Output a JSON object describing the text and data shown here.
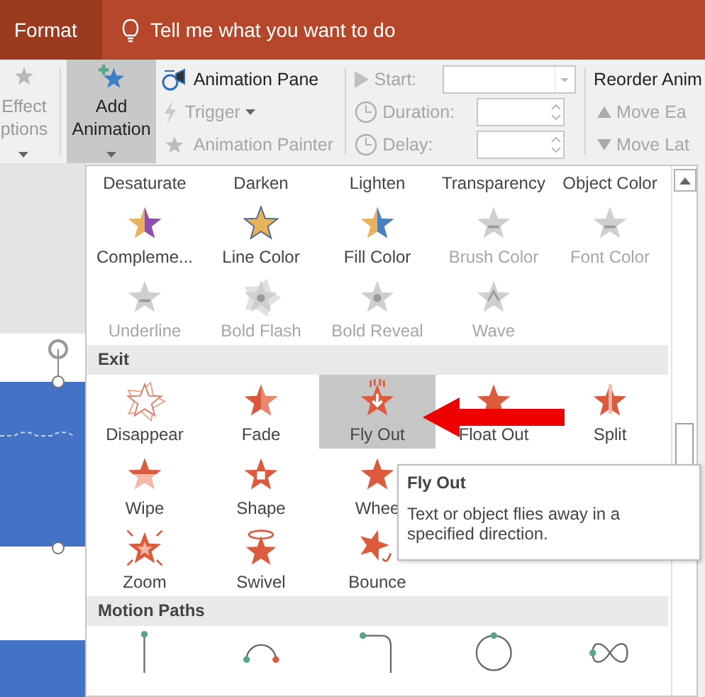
{
  "title_bar": {
    "tabs": [
      {
        "label": "Format",
        "selected": true
      }
    ],
    "tell_me": "Tell me what you want to do"
  },
  "ribbon": {
    "effect_options": {
      "lines": [
        "Effect",
        "ptions"
      ],
      "disabled": true
    },
    "add_animation": {
      "lines": [
        "Add",
        "Animation"
      ],
      "selected": true
    },
    "pane_buttons": [
      {
        "label": "Animation Pane",
        "kind": "pane",
        "disabled": false
      },
      {
        "label": "Trigger",
        "kind": "trigger",
        "disabled": true
      },
      {
        "label": "Animation Painter",
        "kind": "painter",
        "disabled": true
      }
    ],
    "timing": [
      {
        "label": "Start:",
        "kind": "dropdown",
        "disabled": true
      },
      {
        "label": "Duration:",
        "kind": "spinner",
        "disabled": true
      },
      {
        "label": "Delay:",
        "kind": "spinner",
        "disabled": true
      }
    ],
    "reorder": {
      "title": "Reorder Anim",
      "buttons": [
        {
          "label": "Move Ea",
          "kind": "up",
          "disabled": true
        },
        {
          "label": "Move Lat",
          "kind": "down",
          "disabled": true
        }
      ]
    }
  },
  "gallery": {
    "sections": [
      {
        "rows": [
          [
            {
              "label": "Desaturate",
              "disabled": false,
              "selected": false
            },
            {
              "label": "Darken",
              "disabled": false,
              "selected": false
            },
            {
              "label": "Lighten",
              "disabled": false,
              "selected": false
            },
            {
              "label": "Transparency",
              "disabled": false,
              "selected": false
            },
            {
              "label": "Object Color",
              "disabled": false,
              "selected": false
            }
          ],
          [
            {
              "label": "Compleme...",
              "kind": "complementary",
              "disabled": false,
              "selected": false
            },
            {
              "label": "Line Color",
              "kind": "line-color",
              "disabled": false,
              "selected": false
            },
            {
              "label": "Fill Color",
              "kind": "fill-color",
              "disabled": false,
              "selected": false
            },
            {
              "label": "Brush Color",
              "kind": "grey-bar",
              "disabled": true,
              "selected": false
            },
            {
              "label": "Font Color",
              "kind": "grey-bar",
              "disabled": true,
              "selected": false
            }
          ],
          [
            {
              "label": "Underline",
              "kind": "grey-bar",
              "disabled": true,
              "selected": false
            },
            {
              "label": "Bold Flash",
              "kind": "grey-flash",
              "disabled": true,
              "selected": false
            },
            {
              "label": "Bold Reveal",
              "kind": "grey-star",
              "disabled": true,
              "selected": false
            },
            {
              "label": "Wave",
              "kind": "grey-wave",
              "disabled": true,
              "selected": false
            }
          ]
        ]
      },
      {
        "header": "Exit",
        "rows": [
          [
            {
              "label": "Disappear",
              "kind": "disappear",
              "disabled": false,
              "selected": false
            },
            {
              "label": "Fade",
              "kind": "fade",
              "disabled": false,
              "selected": false
            },
            {
              "label": "Fly Out",
              "kind": "fly",
              "disabled": false,
              "selected": true
            },
            {
              "label": "Float Out",
              "kind": "plain",
              "disabled": false,
              "selected": false
            },
            {
              "label": "Split",
              "kind": "split",
              "disabled": false,
              "selected": false
            }
          ],
          [
            {
              "label": "Wipe",
              "kind": "wipe",
              "disabled": false,
              "selected": false
            },
            {
              "label": "Shape",
              "kind": "shape",
              "disabled": false,
              "selected": false
            },
            {
              "label": "Whee",
              "kind": "plain",
              "disabled": false,
              "selected": false
            }
          ],
          [
            {
              "label": "Zoom",
              "kind": "zoom",
              "disabled": false,
              "selected": false
            },
            {
              "label": "Swivel",
              "kind": "swivel",
              "disabled": false,
              "selected": false
            },
            {
              "label": "Bounce",
              "kind": "bounce",
              "disabled": false,
              "selected": false
            }
          ]
        ]
      },
      {
        "header": "Motion Paths",
        "rows": [
          [
            {
              "kind": "path-line",
              "selected": false
            },
            {
              "kind": "path-arc",
              "selected": false
            },
            {
              "kind": "path-turn",
              "selected": false
            },
            {
              "kind": "path-circle",
              "selected": false
            },
            {
              "kind": "path-loop",
              "selected": false
            }
          ]
        ]
      }
    ]
  },
  "tooltip": {
    "title": "Fly Out",
    "text": "Text or object flies away in a specified direction."
  }
}
